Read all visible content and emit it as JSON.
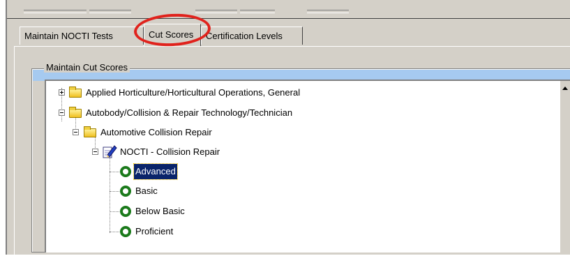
{
  "tabs": [
    {
      "label": "Maintain NOCTI Tests",
      "active": false
    },
    {
      "label": "Cut Scores",
      "active": true
    },
    {
      "label": "Certification Levels",
      "active": false
    }
  ],
  "group": {
    "title": "Maintain Cut Scores"
  },
  "tree": {
    "items": [
      {
        "label": "Applied Horticulture/Horticultural Operations, General",
        "type": "folder",
        "expander": "plus"
      },
      {
        "label": "Autobody/Collision & Repair Technology/Technician",
        "type": "folder",
        "expander": "minus"
      },
      {
        "label": "Automotive Collision Repair",
        "type": "folder",
        "expander": "minus"
      },
      {
        "label": "NOCTI - Collision Repair",
        "type": "test",
        "expander": "minus"
      },
      {
        "label": "Advanced",
        "type": "level",
        "selected": true
      },
      {
        "label": "Basic",
        "type": "level"
      },
      {
        "label": "Below Basic",
        "type": "level"
      },
      {
        "label": "Proficient",
        "type": "level"
      }
    ]
  },
  "colors": {
    "highlight_ring": "#e0221c",
    "selection": "#0a246a",
    "level_icon": "#1b7a1b",
    "window_face": "#d4d0c8"
  }
}
